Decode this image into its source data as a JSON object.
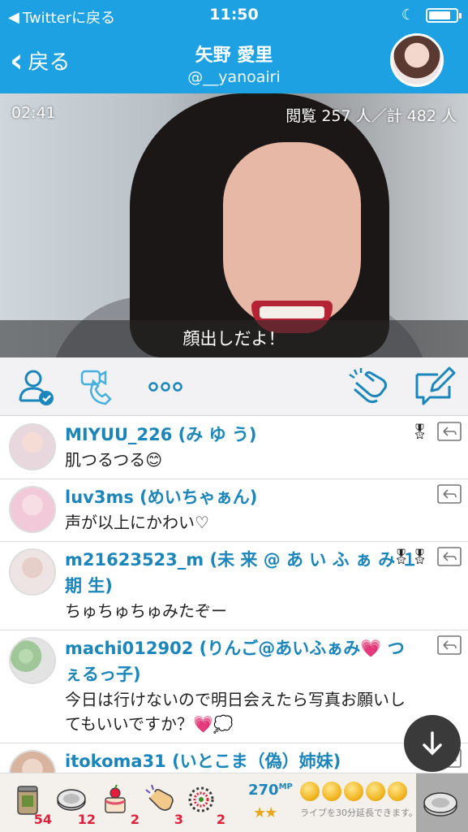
{
  "status_bar": {
    "back_app_label": "Twitterに戻る",
    "time": "11:50",
    "battery_level": 0.8
  },
  "header": {
    "back_label": "戻る",
    "user_name": "矢野 愛里",
    "user_handle": "@__yanoairi"
  },
  "video": {
    "elapsed": "02:41",
    "views_text": "閲覧 257 人／計 482 人",
    "caption": "顔出しだよ！"
  },
  "actions": {
    "icons": [
      "follow-user-icon",
      "call-request-icon",
      "more-icon",
      "clap-icon",
      "compose-comment-icon"
    ]
  },
  "comments": [
    {
      "name": "MIYUU_226 (み ゆ う)",
      "text": "肌つるつる😊",
      "badge": "🎖",
      "avatar_color": "#e9d7de"
    },
    {
      "name": "luv3ms (めいちゃぁん)",
      "text": "声が以上にかわい♡",
      "badge": "",
      "avatar_color": "#f1c9d8"
    },
    {
      "name": "m21623523_m (未 来 @ あ い ふ ぁ み １期 生)",
      "text": "ちゅちゅちゅみたぞー",
      "badge": "🎖🎖",
      "avatar_color": "#efe4e4"
    },
    {
      "name": "machi012902 (りんご@あいふぁみ💗 つぇるっ子)",
      "text": "今日は行けないので明日会えたら写真お願いしてもいいですか？💗💭",
      "badge": "",
      "avatar_color": "#9fc79a"
    },
    {
      "name": "itokoma31 (いとこま（偽）姉妹)",
      "text": "",
      "badge": "🎖",
      "avatar_color": "#d8b49e"
    }
  ],
  "gift_bar": {
    "gifts": [
      {
        "icon": "tea-can-icon",
        "count": "54"
      },
      {
        "icon": "coin-disc-icon",
        "count": "12"
      },
      {
        "icon": "cake-icon",
        "count": "2"
      },
      {
        "icon": "clap-hands-icon",
        "count": "3"
      },
      {
        "icon": "firework-icon",
        "count": "2"
      }
    ],
    "mp_value": "270",
    "mp_unit": "MP",
    "stars": "★★",
    "extend_text": "ライブを30分延長できます。",
    "coin_count": 5
  }
}
